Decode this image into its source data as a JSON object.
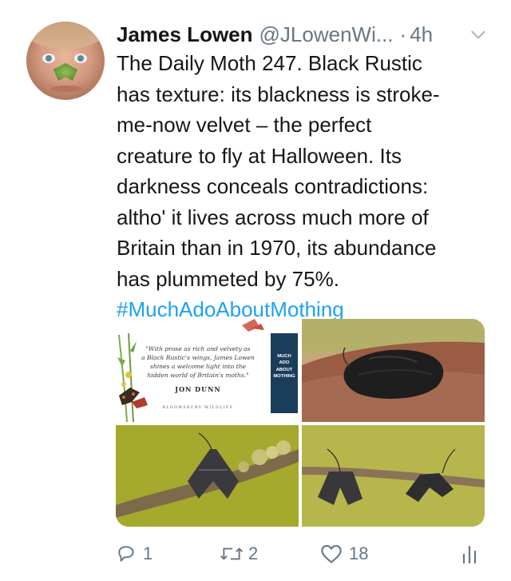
{
  "tweet": {
    "author_name": "James Lowen",
    "handle": "@JLowenWi...",
    "separator": "·",
    "time": "4h",
    "text_lines": [
      "The Daily Moth 247. Black Rustic",
      "has texture: its blackness is stroke-",
      "me-now velvet – the perfect",
      "creature to fly at Halloween. Its",
      "darkness conceals contradictions:",
      "altho' it lives across much more of",
      "Britain than in 1970, its abundance",
      "has plummeted by 75%."
    ],
    "hashtag": "#MuchAdoAboutMothing"
  },
  "media": {
    "book_card": {
      "quote": "\"With prose as rich and velvety as\na Black Rustic's wings, James Lowen\nshines a welcome light into the\nhidden world of Britain's moths.\"",
      "author": "JON DUNN",
      "publisher": "BLOOMSBURY WILDLIFE",
      "book_title": "MUCH\nADO\nABOUT\nMOTHING"
    }
  },
  "actions": {
    "replies": "1",
    "retweets": "2",
    "likes": "18"
  },
  "colors": {
    "text": "#14171a",
    "secondary": "#657786",
    "link": "#1da1f2"
  }
}
